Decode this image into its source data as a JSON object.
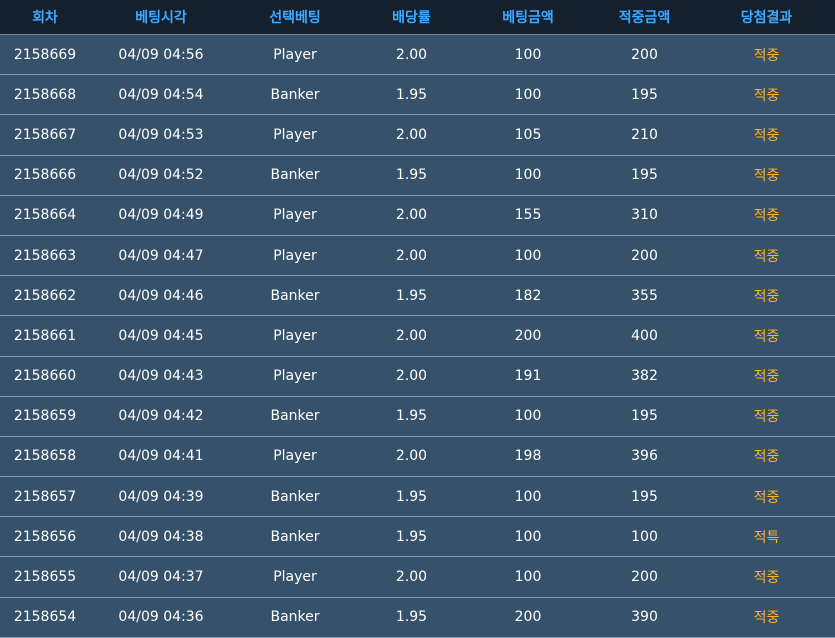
{
  "table": {
    "columns": [
      "회차",
      "베팅시각",
      "선택베팅",
      "배당률",
      "베팅금액",
      "적중금액",
      "당첨결과"
    ],
    "rows": [
      {
        "round": "2158669",
        "time": "04/09 04:56",
        "pick": "Player",
        "odds": "2.00",
        "bet": "100",
        "win": "200",
        "result": "적중"
      },
      {
        "round": "2158668",
        "time": "04/09 04:54",
        "pick": "Banker",
        "odds": "1.95",
        "bet": "100",
        "win": "195",
        "result": "적중"
      },
      {
        "round": "2158667",
        "time": "04/09 04:53",
        "pick": "Player",
        "odds": "2.00",
        "bet": "105",
        "win": "210",
        "result": "적중"
      },
      {
        "round": "2158666",
        "time": "04/09 04:52",
        "pick": "Banker",
        "odds": "1.95",
        "bet": "100",
        "win": "195",
        "result": "적중"
      },
      {
        "round": "2158664",
        "time": "04/09 04:49",
        "pick": "Player",
        "odds": "2.00",
        "bet": "155",
        "win": "310",
        "result": "적중"
      },
      {
        "round": "2158663",
        "time": "04/09 04:47",
        "pick": "Player",
        "odds": "2.00",
        "bet": "100",
        "win": "200",
        "result": "적중"
      },
      {
        "round": "2158662",
        "time": "04/09 04:46",
        "pick": "Banker",
        "odds": "1.95",
        "bet": "182",
        "win": "355",
        "result": "적중"
      },
      {
        "round": "2158661",
        "time": "04/09 04:45",
        "pick": "Player",
        "odds": "2.00",
        "bet": "200",
        "win": "400",
        "result": "적중"
      },
      {
        "round": "2158660",
        "time": "04/09 04:43",
        "pick": "Player",
        "odds": "2.00",
        "bet": "191",
        "win": "382",
        "result": "적중"
      },
      {
        "round": "2158659",
        "time": "04/09 04:42",
        "pick": "Banker",
        "odds": "1.95",
        "bet": "100",
        "win": "195",
        "result": "적중"
      },
      {
        "round": "2158658",
        "time": "04/09 04:41",
        "pick": "Player",
        "odds": "2.00",
        "bet": "198",
        "win": "396",
        "result": "적중"
      },
      {
        "round": "2158657",
        "time": "04/09 04:39",
        "pick": "Banker",
        "odds": "1.95",
        "bet": "100",
        "win": "195",
        "result": "적중"
      },
      {
        "round": "2158656",
        "time": "04/09 04:38",
        "pick": "Banker",
        "odds": "1.95",
        "bet": "100",
        "win": "100",
        "result": "적특"
      },
      {
        "round": "2158655",
        "time": "04/09 04:37",
        "pick": "Player",
        "odds": "2.00",
        "bet": "100",
        "win": "200",
        "result": "적중"
      },
      {
        "round": "2158654",
        "time": "04/09 04:36",
        "pick": "Banker",
        "odds": "1.95",
        "bet": "200",
        "win": "390",
        "result": "적중"
      }
    ]
  }
}
